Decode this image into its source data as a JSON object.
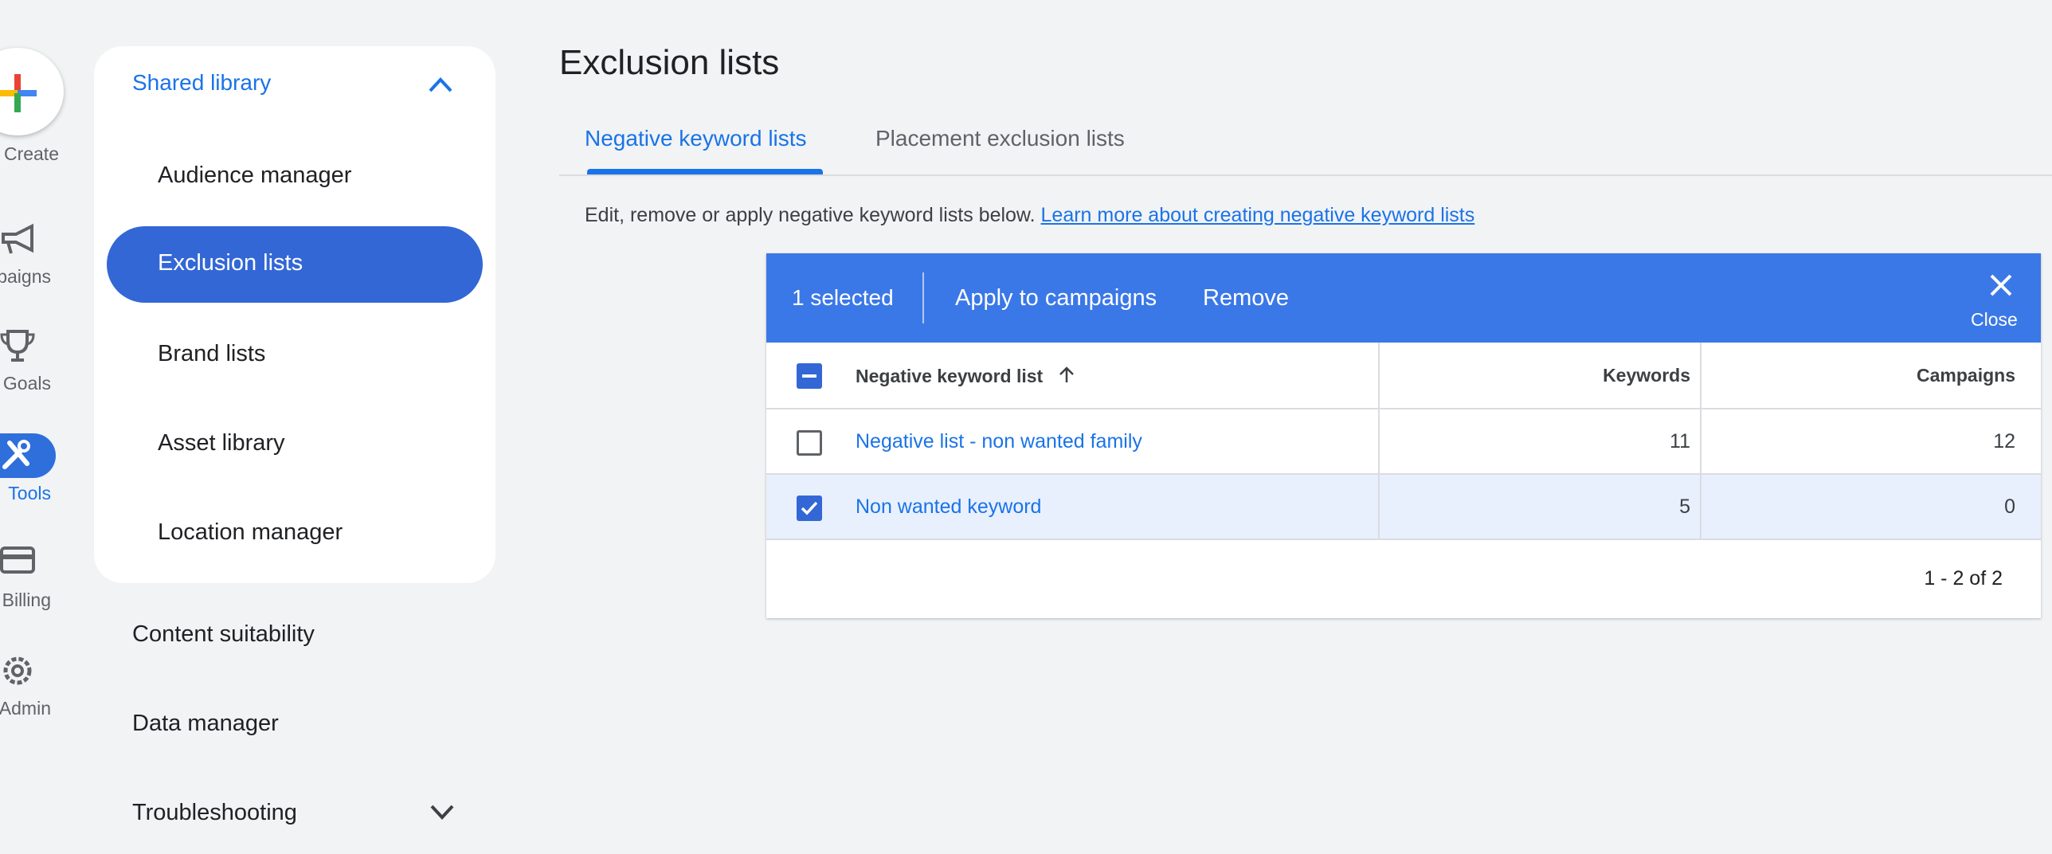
{
  "rail": {
    "create_label": "Create",
    "items": [
      {
        "label": "Campaigns",
        "icon": "megaphone-icon"
      },
      {
        "label": "Goals",
        "icon": "trophy-icon"
      },
      {
        "label": "Tools",
        "icon": "tools-icon",
        "active": true
      },
      {
        "label": "Billing",
        "icon": "credit-card-icon"
      },
      {
        "label": "Admin",
        "icon": "gear-icon"
      }
    ]
  },
  "sidebar": {
    "section_title": "Shared library",
    "items": [
      "Audience manager",
      "Exclusion lists",
      "Brand lists",
      "Asset library",
      "Location manager"
    ],
    "active_item": "Exclusion lists",
    "nav": [
      "Content suitability",
      "Data manager",
      "Troubleshooting"
    ]
  },
  "main": {
    "title": "Exclusion lists",
    "tabs": [
      {
        "label": "Negative keyword lists",
        "active": true
      },
      {
        "label": "Placement exclusion lists",
        "active": false
      }
    ],
    "description": "Edit, remove or apply negative keyword lists below.",
    "learn_more": "Learn more about creating negative keyword lists"
  },
  "selection_bar": {
    "count": "1 selected",
    "apply": "Apply to campaigns",
    "remove": "Remove",
    "close": "Close"
  },
  "table": {
    "headers": {
      "name": "Negative keyword list",
      "keywords": "Keywords",
      "campaigns": "Campaigns"
    },
    "rows": [
      {
        "name": "Negative list - non wanted family",
        "keywords": "11",
        "campaigns": "12",
        "checked": false
      },
      {
        "name": "Non wanted keyword",
        "keywords": "5",
        "campaigns": "0",
        "checked": true
      }
    ],
    "pagination": "1 - 2 of 2"
  },
  "colors": {
    "primary": "#1a73e8",
    "selection_bar": "#3b78e7",
    "selected_row": "#e8f0fe"
  }
}
